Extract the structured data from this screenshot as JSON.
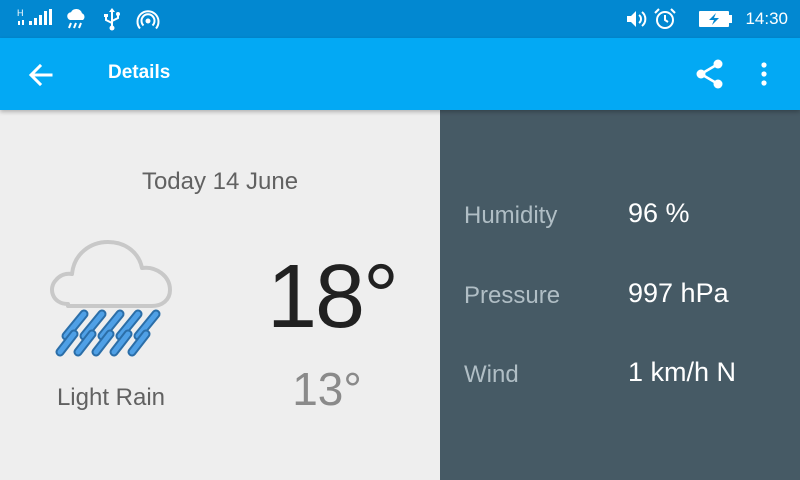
{
  "status_bar": {
    "icons": [
      "signal-icon",
      "weather-notification-icon",
      "usb-icon",
      "hotspot-icon",
      "volume-icon",
      "alarm-icon",
      "battery-charging-icon"
    ],
    "signal_type": "H",
    "time": "14:30"
  },
  "app_bar": {
    "title": "Details",
    "back_icon": "arrow-back-icon",
    "share_icon": "share-icon",
    "menu_icon": "more-vert-icon"
  },
  "forecast": {
    "date": "Today 14 June",
    "condition": "Light Rain",
    "icon": "light-rain-icon",
    "high": "18°",
    "low": "13°"
  },
  "details": [
    {
      "label": "Humidity",
      "value": "96 %"
    },
    {
      "label": "Pressure",
      "value": "997 hPa"
    },
    {
      "label": "Wind",
      "value": "1 km/h N"
    }
  ],
  "colors": {
    "status_bar": "#0288d1",
    "app_bar": "#03a9f4",
    "left_panel": "#eeeeee",
    "right_panel": "#465a65",
    "rain_accent": "#3a8fd8"
  }
}
